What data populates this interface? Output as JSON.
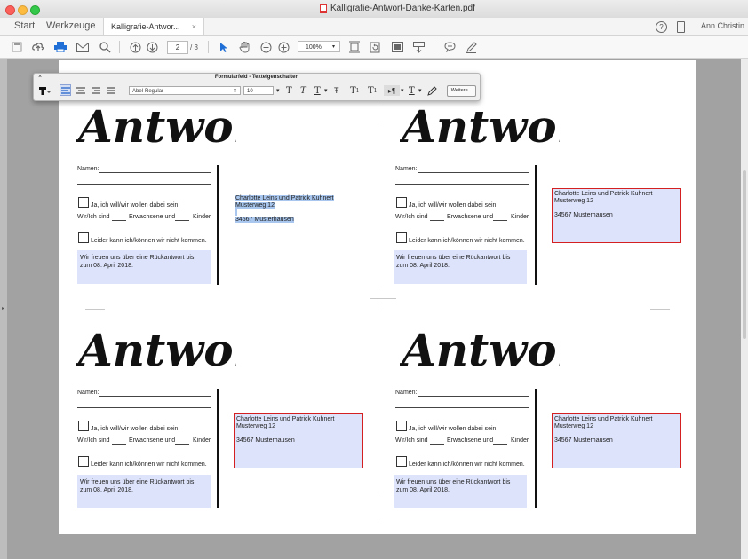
{
  "window": {
    "title": "Kalligrafie-Antwort-Danke-Karten.pdf"
  },
  "nav": {
    "start": "Start",
    "tools": "Werkzeuge",
    "tab_label": "Kalligrafie-Antwor...",
    "tab_close": "×",
    "help": "?",
    "user": "Ann Christin"
  },
  "toolbar": {
    "page_current": "2",
    "page_total": "/ 3",
    "zoom": "100%",
    "icons": [
      "save-icon",
      "upload-icon",
      "print-icon",
      "mail-icon",
      "search-icon",
      "page-up-icon",
      "page-down-icon",
      "select-arrow-icon",
      "hand-icon",
      "zoom-out-icon",
      "zoom-in-icon",
      "fit-page-icon",
      "rotate-icon",
      "fullscreen-icon",
      "scroll-mode-icon",
      "comment-icon",
      "pen-icon"
    ]
  },
  "panel": {
    "title": "Formularfeld - Texteigenschaften",
    "close": "×",
    "font": "Abel-Regular",
    "size": "10",
    "more": "Weitere..."
  },
  "card": {
    "title": "Antwort",
    "names_label": "Namen:",
    "yes_label": "Ja, ich will/wir wollen dabei sein!",
    "count_prefix": "Wir/Ich sind",
    "count_adults": "Erwachsene und",
    "count_kids": "Kinder",
    "no_label": "Leider kann ich/können wir nicht kommen.",
    "reply_note_1": "Wir freuen uns über eine Rückantwort bis",
    "reply_note_2": "zum 08. April 2018."
  },
  "address": {
    "line1": "Charlotte Leins und Patrick Kuhnert",
    "line2": "Musterweg 12",
    "line3": "34567 Musterhausen"
  },
  "colors": {
    "field_fill": "#dde3fb",
    "field_border": "#d42020",
    "selection": "#a8c6ee",
    "canvas": "#a2a2a2"
  }
}
